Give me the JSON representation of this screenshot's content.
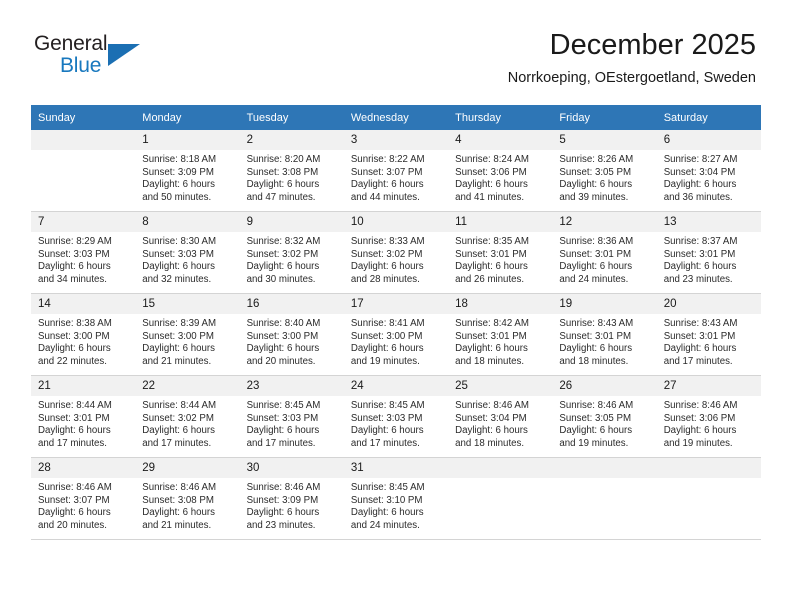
{
  "brand": {
    "name_top": "General",
    "name_bottom": "Blue",
    "accent_color": "#1878be",
    "triangle_color": "#1b6fb3"
  },
  "header": {
    "title": "December 2025",
    "subtitle": "Norrkoeping, OEstergoetland, Sweden"
  },
  "calendar": {
    "header_bg": "#2e76b6",
    "daynum_bg": "#f1f1f1",
    "weekdays": [
      "Sunday",
      "Monday",
      "Tuesday",
      "Wednesday",
      "Thursday",
      "Friday",
      "Saturday"
    ],
    "labels": {
      "sunrise": "Sunrise:",
      "sunset": "Sunset:",
      "daylight": "Daylight:"
    },
    "weeks": [
      [
        {
          "day": "",
          "empty": true
        },
        {
          "day": "1",
          "sunrise": "Sunrise: 8:18 AM",
          "sunset": "Sunset: 3:09 PM",
          "daylight_1": "Daylight: 6 hours",
          "daylight_2": "and 50 minutes."
        },
        {
          "day": "2",
          "sunrise": "Sunrise: 8:20 AM",
          "sunset": "Sunset: 3:08 PM",
          "daylight_1": "Daylight: 6 hours",
          "daylight_2": "and 47 minutes."
        },
        {
          "day": "3",
          "sunrise": "Sunrise: 8:22 AM",
          "sunset": "Sunset: 3:07 PM",
          "daylight_1": "Daylight: 6 hours",
          "daylight_2": "and 44 minutes."
        },
        {
          "day": "4",
          "sunrise": "Sunrise: 8:24 AM",
          "sunset": "Sunset: 3:06 PM",
          "daylight_1": "Daylight: 6 hours",
          "daylight_2": "and 41 minutes."
        },
        {
          "day": "5",
          "sunrise": "Sunrise: 8:26 AM",
          "sunset": "Sunset: 3:05 PM",
          "daylight_1": "Daylight: 6 hours",
          "daylight_2": "and 39 minutes."
        },
        {
          "day": "6",
          "sunrise": "Sunrise: 8:27 AM",
          "sunset": "Sunset: 3:04 PM",
          "daylight_1": "Daylight: 6 hours",
          "daylight_2": "and 36 minutes."
        }
      ],
      [
        {
          "day": "7",
          "sunrise": "Sunrise: 8:29 AM",
          "sunset": "Sunset: 3:03 PM",
          "daylight_1": "Daylight: 6 hours",
          "daylight_2": "and 34 minutes."
        },
        {
          "day": "8",
          "sunrise": "Sunrise: 8:30 AM",
          "sunset": "Sunset: 3:03 PM",
          "daylight_1": "Daylight: 6 hours",
          "daylight_2": "and 32 minutes."
        },
        {
          "day": "9",
          "sunrise": "Sunrise: 8:32 AM",
          "sunset": "Sunset: 3:02 PM",
          "daylight_1": "Daylight: 6 hours",
          "daylight_2": "and 30 minutes."
        },
        {
          "day": "10",
          "sunrise": "Sunrise: 8:33 AM",
          "sunset": "Sunset: 3:02 PM",
          "daylight_1": "Daylight: 6 hours",
          "daylight_2": "and 28 minutes."
        },
        {
          "day": "11",
          "sunrise": "Sunrise: 8:35 AM",
          "sunset": "Sunset: 3:01 PM",
          "daylight_1": "Daylight: 6 hours",
          "daylight_2": "and 26 minutes."
        },
        {
          "day": "12",
          "sunrise": "Sunrise: 8:36 AM",
          "sunset": "Sunset: 3:01 PM",
          "daylight_1": "Daylight: 6 hours",
          "daylight_2": "and 24 minutes."
        },
        {
          "day": "13",
          "sunrise": "Sunrise: 8:37 AM",
          "sunset": "Sunset: 3:01 PM",
          "daylight_1": "Daylight: 6 hours",
          "daylight_2": "and 23 minutes."
        }
      ],
      [
        {
          "day": "14",
          "sunrise": "Sunrise: 8:38 AM",
          "sunset": "Sunset: 3:00 PM",
          "daylight_1": "Daylight: 6 hours",
          "daylight_2": "and 22 minutes."
        },
        {
          "day": "15",
          "sunrise": "Sunrise: 8:39 AM",
          "sunset": "Sunset: 3:00 PM",
          "daylight_1": "Daylight: 6 hours",
          "daylight_2": "and 21 minutes."
        },
        {
          "day": "16",
          "sunrise": "Sunrise: 8:40 AM",
          "sunset": "Sunset: 3:00 PM",
          "daylight_1": "Daylight: 6 hours",
          "daylight_2": "and 20 minutes."
        },
        {
          "day": "17",
          "sunrise": "Sunrise: 8:41 AM",
          "sunset": "Sunset: 3:00 PM",
          "daylight_1": "Daylight: 6 hours",
          "daylight_2": "and 19 minutes."
        },
        {
          "day": "18",
          "sunrise": "Sunrise: 8:42 AM",
          "sunset": "Sunset: 3:01 PM",
          "daylight_1": "Daylight: 6 hours",
          "daylight_2": "and 18 minutes."
        },
        {
          "day": "19",
          "sunrise": "Sunrise: 8:43 AM",
          "sunset": "Sunset: 3:01 PM",
          "daylight_1": "Daylight: 6 hours",
          "daylight_2": "and 18 minutes."
        },
        {
          "day": "20",
          "sunrise": "Sunrise: 8:43 AM",
          "sunset": "Sunset: 3:01 PM",
          "daylight_1": "Daylight: 6 hours",
          "daylight_2": "and 17 minutes."
        }
      ],
      [
        {
          "day": "21",
          "sunrise": "Sunrise: 8:44 AM",
          "sunset": "Sunset: 3:01 PM",
          "daylight_1": "Daylight: 6 hours",
          "daylight_2": "and 17 minutes."
        },
        {
          "day": "22",
          "sunrise": "Sunrise: 8:44 AM",
          "sunset": "Sunset: 3:02 PM",
          "daylight_1": "Daylight: 6 hours",
          "daylight_2": "and 17 minutes."
        },
        {
          "day": "23",
          "sunrise": "Sunrise: 8:45 AM",
          "sunset": "Sunset: 3:03 PM",
          "daylight_1": "Daylight: 6 hours",
          "daylight_2": "and 17 minutes."
        },
        {
          "day": "24",
          "sunrise": "Sunrise: 8:45 AM",
          "sunset": "Sunset: 3:03 PM",
          "daylight_1": "Daylight: 6 hours",
          "daylight_2": "and 17 minutes."
        },
        {
          "day": "25",
          "sunrise": "Sunrise: 8:46 AM",
          "sunset": "Sunset: 3:04 PM",
          "daylight_1": "Daylight: 6 hours",
          "daylight_2": "and 18 minutes."
        },
        {
          "day": "26",
          "sunrise": "Sunrise: 8:46 AM",
          "sunset": "Sunset: 3:05 PM",
          "daylight_1": "Daylight: 6 hours",
          "daylight_2": "and 19 minutes."
        },
        {
          "day": "27",
          "sunrise": "Sunrise: 8:46 AM",
          "sunset": "Sunset: 3:06 PM",
          "daylight_1": "Daylight: 6 hours",
          "daylight_2": "and 19 minutes."
        }
      ],
      [
        {
          "day": "28",
          "sunrise": "Sunrise: 8:46 AM",
          "sunset": "Sunset: 3:07 PM",
          "daylight_1": "Daylight: 6 hours",
          "daylight_2": "and 20 minutes."
        },
        {
          "day": "29",
          "sunrise": "Sunrise: 8:46 AM",
          "sunset": "Sunset: 3:08 PM",
          "daylight_1": "Daylight: 6 hours",
          "daylight_2": "and 21 minutes."
        },
        {
          "day": "30",
          "sunrise": "Sunrise: 8:46 AM",
          "sunset": "Sunset: 3:09 PM",
          "daylight_1": "Daylight: 6 hours",
          "daylight_2": "and 23 minutes."
        },
        {
          "day": "31",
          "sunrise": "Sunrise: 8:45 AM",
          "sunset": "Sunset: 3:10 PM",
          "daylight_1": "Daylight: 6 hours",
          "daylight_2": "and 24 minutes."
        },
        {
          "day": "",
          "empty": true
        },
        {
          "day": "",
          "empty": true
        },
        {
          "day": "",
          "empty": true
        }
      ]
    ]
  }
}
